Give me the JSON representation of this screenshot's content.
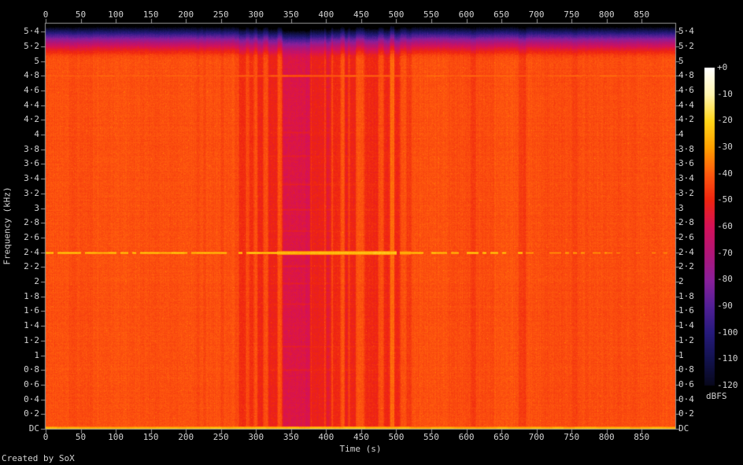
{
  "credit": "Created by SoX",
  "axes": {
    "x": {
      "label": "Time (s)",
      "ticks": [
        {
          "label": "0",
          "s": 0
        },
        {
          "label": "50",
          "s": 50
        },
        {
          "label": "100",
          "s": 100
        },
        {
          "label": "150",
          "s": 150
        },
        {
          "label": "200",
          "s": 200
        },
        {
          "label": "250",
          "s": 250
        },
        {
          "label": "300",
          "s": 300
        },
        {
          "label": "350",
          "s": 350
        },
        {
          "label": "400",
          "s": 400
        },
        {
          "label": "450",
          "s": 450
        },
        {
          "label": "500",
          "s": 500
        },
        {
          "label": "550",
          "s": 550
        },
        {
          "label": "600",
          "s": 600
        },
        {
          "label": "650",
          "s": 650
        },
        {
          "label": "700",
          "s": 700
        },
        {
          "label": "750",
          "s": 750
        },
        {
          "label": "800",
          "s": 800
        },
        {
          "label": "850",
          "s": 850
        }
      ]
    },
    "y": {
      "label": "Frequency (kHz)",
      "ticks": [
        {
          "label": "DC",
          "khz": 0
        },
        {
          "label": "0·2",
          "khz": 0.2
        },
        {
          "label": "0·4",
          "khz": 0.4
        },
        {
          "label": "0·6",
          "khz": 0.6
        },
        {
          "label": "0·8",
          "khz": 0.8
        },
        {
          "label": "1",
          "khz": 1.0
        },
        {
          "label": "1·2",
          "khz": 1.2
        },
        {
          "label": "1·4",
          "khz": 1.4
        },
        {
          "label": "1·6",
          "khz": 1.6
        },
        {
          "label": "1·8",
          "khz": 1.8
        },
        {
          "label": "2",
          "khz": 2.0
        },
        {
          "label": "2·2",
          "khz": 2.2
        },
        {
          "label": "2·4",
          "khz": 2.4
        },
        {
          "label": "2·6",
          "khz": 2.6
        },
        {
          "label": "2·8",
          "khz": 2.8
        },
        {
          "label": "3",
          "khz": 3.0
        },
        {
          "label": "3·2",
          "khz": 3.2
        },
        {
          "label": "3·4",
          "khz": 3.4
        },
        {
          "label": "3·6",
          "khz": 3.6
        },
        {
          "label": "3·8",
          "khz": 3.8
        },
        {
          "label": "4",
          "khz": 4.0
        },
        {
          "label": "4·2",
          "khz": 4.2
        },
        {
          "label": "4·4",
          "khz": 4.4
        },
        {
          "label": "4·6",
          "khz": 4.6
        },
        {
          "label": "4·8",
          "khz": 4.8
        },
        {
          "label": "5",
          "khz": 5.0
        },
        {
          "label": "5·2",
          "khz": 5.2
        },
        {
          "label": "5·4",
          "khz": 5.4
        }
      ]
    }
  },
  "colorbar": {
    "label": "dBFS",
    "ticks": [
      {
        "label": "+0",
        "dbfs": 0
      },
      {
        "label": "-10",
        "dbfs": -10
      },
      {
        "label": "-20",
        "dbfs": -20
      },
      {
        "label": "-30",
        "dbfs": -30
      },
      {
        "label": "-40",
        "dbfs": -40
      },
      {
        "label": "-50",
        "dbfs": -50
      },
      {
        "label": "-60",
        "dbfs": -60
      },
      {
        "label": "-70",
        "dbfs": -70
      },
      {
        "label": "-80",
        "dbfs": -80
      },
      {
        "label": "-90",
        "dbfs": -90
      },
      {
        "label": "-100",
        "dbfs": -100
      },
      {
        "label": "-110",
        "dbfs": -110
      },
      {
        "label": "-120",
        "dbfs": -120
      }
    ]
  },
  "chart_data": {
    "type": "heatmap",
    "subtype": "audio-spectrogram",
    "title": "Created by SoX",
    "xlabel": "Time (s)",
    "ylabel": "Frequency (kHz)",
    "xlim_s": [
      0,
      898
    ],
    "ylim_khz": [
      0,
      5.509
    ],
    "x_tick_step_s": 50,
    "y_tick_step_khz": 0.2,
    "colorbar": {
      "label": "dBFS",
      "min": -120,
      "max": 0,
      "tick_step": 10
    },
    "background_level_dbfs": -42,
    "palette": [
      {
        "dbfs": -125,
        "hex": "#000000"
      },
      {
        "dbfs": -120,
        "hex": "#08081c"
      },
      {
        "dbfs": -110,
        "hex": "#12124e"
      },
      {
        "dbfs": -100,
        "hex": "#261a7c"
      },
      {
        "dbfs": -90,
        "hex": "#521f96"
      },
      {
        "dbfs": -80,
        "hex": "#8a1f9a"
      },
      {
        "dbfs": -70,
        "hex": "#b01578"
      },
      {
        "dbfs": -60,
        "hex": "#d41159"
      },
      {
        "dbfs": -50,
        "hex": "#ef2410"
      },
      {
        "dbfs": -40,
        "hex": "#ff5a0e"
      },
      {
        "dbfs": -30,
        "hex": "#ffa000"
      },
      {
        "dbfs": -20,
        "hex": "#ffd518"
      },
      {
        "dbfs": -10,
        "hex": "#fff5b0"
      },
      {
        "dbfs": 0,
        "hex": "#ffffff"
      }
    ],
    "features": {
      "nyquist_rolloff": {
        "from_khz": 5.02,
        "to_khz": 5.509,
        "floor_dbfs": -125
      },
      "tones": [
        {
          "khz": 2.4,
          "peak_dbfs": -21,
          "solid_range_s": [
            290,
            500
          ],
          "dashed_until_s": 680,
          "faint_until_s": 800,
          "note": "strong tonal line, dashed before 290 s and after 500 s, fading to the right"
        },
        {
          "khz": 4.8,
          "peak_dbfs": -38,
          "note": "very faint tonal line across full width"
        },
        {
          "khz": 0.0,
          "peak_dbfs": -26,
          "note": "bright yellow-orange line along DC edge"
        }
      ],
      "quiet_bands_s_db": [
        [
          216,
          219,
          3
        ],
        [
          225,
          228,
          2
        ],
        [
          249,
          254,
          3
        ],
        [
          275,
          285,
          6
        ],
        [
          290,
          296,
          6
        ],
        [
          302,
          310,
          8
        ],
        [
          317,
          330,
          9
        ],
        [
          337,
          377,
          16
        ],
        [
          378,
          397,
          9
        ],
        [
          399,
          407,
          12
        ],
        [
          409,
          420,
          8
        ],
        [
          426,
          431,
          11
        ],
        [
          433,
          442,
          9
        ],
        [
          454,
          474,
          8
        ],
        [
          482,
          490,
          8
        ],
        [
          497,
          505,
          8
        ],
        [
          514,
          521,
          4
        ],
        [
          605,
          613,
          3
        ],
        [
          674,
          685,
          4
        ],
        [
          751,
          758,
          2
        ]
      ],
      "loud_bands_s_db": [
        [
          491,
          497,
          4
        ]
      ]
    }
  }
}
